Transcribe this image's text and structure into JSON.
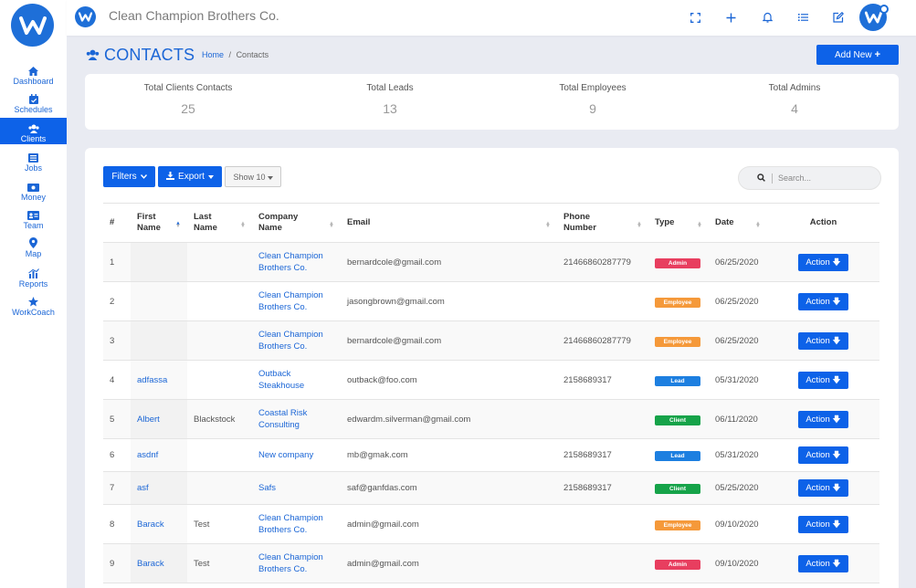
{
  "app": {
    "company_name": "Clean Champion Brothers Co.",
    "accent": "#0d62e8"
  },
  "sidebar": {
    "items": [
      {
        "label": "Dashboard",
        "icon": "home-icon"
      },
      {
        "label": "Schedules",
        "icon": "calendar-icon"
      },
      {
        "label": "Clients",
        "icon": "clients-icon",
        "active": true
      },
      {
        "label": "Jobs",
        "icon": "list-icon"
      },
      {
        "label": "Money",
        "icon": "money-icon"
      },
      {
        "label": "Team",
        "icon": "id-card-icon"
      },
      {
        "label": "Map",
        "icon": "map-pin-icon"
      },
      {
        "label": "Reports",
        "icon": "bar-chart-icon"
      },
      {
        "label": "WorkCoach",
        "icon": "star-icon"
      }
    ]
  },
  "topbar": {
    "icons": [
      "fullscreen-icon",
      "plus-icon",
      "bell-icon",
      "list-icon",
      "edit-icon"
    ]
  },
  "page": {
    "title": "CONTACTS",
    "breadcrumb_home": "Home",
    "breadcrumb_sep": "/",
    "breadcrumb_current": "Contacts",
    "add_new_label": "Add New"
  },
  "stats": [
    {
      "label": "Total Clients Contacts",
      "value": "25"
    },
    {
      "label": "Total Leads",
      "value": "13"
    },
    {
      "label": "Total Employees",
      "value": "9"
    },
    {
      "label": "Total Admins",
      "value": "4"
    }
  ],
  "toolbar": {
    "filters_label": "Filters",
    "export_label": "Export",
    "show_label": "Show 10",
    "search_placeholder": "Search..."
  },
  "table": {
    "headers": {
      "num": "#",
      "first_name": "First Name",
      "last_name": "Last Name",
      "company_name": "Company Name",
      "email": "Email",
      "phone": "Phone Number",
      "type": "Type",
      "date": "Date",
      "action": "Action"
    },
    "action_label": "Action",
    "rows": [
      {
        "num": "1",
        "first": "",
        "last": "",
        "company": "Clean Champion Brothers Co.",
        "email": "bernardcole@gmail.com",
        "phone": "21466860287779",
        "type": "Admin",
        "type_color": "#e83e5f",
        "date": "06/25/2020"
      },
      {
        "num": "2",
        "first": "",
        "last": "",
        "company": "Clean Champion Brothers Co.",
        "email": "jasongbrown@gmail.com",
        "phone": "",
        "type": "Employee",
        "type_color": "#f5993a",
        "date": "06/25/2020"
      },
      {
        "num": "3",
        "first": "",
        "last": "",
        "company": "Clean Champion Brothers Co.",
        "email": "bernardcole@gmail.com",
        "phone": "21466860287779",
        "type": "Employee",
        "type_color": "#f5993a",
        "date": "06/25/2020"
      },
      {
        "num": "4",
        "first": "adfassa",
        "last": "",
        "company": "Outback Steakhouse",
        "email": "outback@foo.com",
        "phone": "2158689317",
        "type": "Lead",
        "type_color": "#1d7fe0",
        "date": "05/31/2020"
      },
      {
        "num": "5",
        "first": "Albert",
        "last": "Blackstock",
        "company": "Coastal Risk Consulting",
        "email": "edwardm.silverman@gmail.com",
        "phone": "",
        "type": "Client",
        "type_color": "#16a349",
        "date": "06/11/2020"
      },
      {
        "num": "6",
        "first": "asdnf",
        "last": "",
        "company": "New company",
        "email": "mb@gmak.com",
        "phone": "2158689317",
        "type": "Lead",
        "type_color": "#1d7fe0",
        "date": "05/31/2020"
      },
      {
        "num": "7",
        "first": "asf",
        "last": "",
        "company": "Safs",
        "email": "saf@ganfdas.com",
        "phone": "2158689317",
        "type": "Client",
        "type_color": "#16a349",
        "date": "05/25/2020"
      },
      {
        "num": "8",
        "first": "Barack",
        "last": "Test",
        "company": "Clean Champion Brothers Co.",
        "email": "admin@gmail.com",
        "phone": "",
        "type": "Employee",
        "type_color": "#f5993a",
        "date": "09/10/2020"
      },
      {
        "num": "9",
        "first": "Barack",
        "last": "Test",
        "company": "Clean Champion Brothers Co.",
        "email": "admin@gmail.com",
        "phone": "",
        "type": "Admin",
        "type_color": "#e83e5f",
        "date": "09/10/2020"
      }
    ]
  }
}
